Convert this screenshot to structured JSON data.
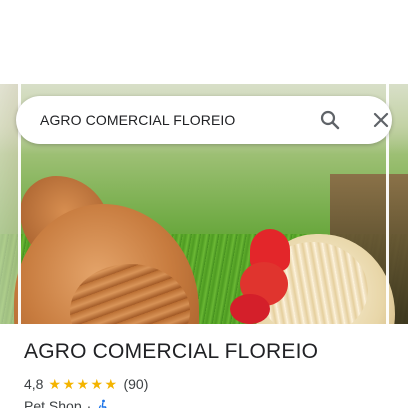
{
  "search": {
    "query": "AGRO COMERCIAL FLOREIO"
  },
  "place": {
    "name": "AGRO COMERCIAL FLOREIO",
    "rating": "4,8",
    "stars": 5,
    "reviews": "(90)",
    "category": "Pet Shop",
    "separator": "·"
  },
  "icons": {
    "search": "search-icon",
    "close": "close-icon",
    "star": "star-icon",
    "accessibility": "wheelchair-accessible-icon"
  },
  "colors": {
    "star": "#f4b400",
    "accessibility": "#1a73e8",
    "text_primary": "#202124",
    "text_secondary": "#3c4043"
  }
}
